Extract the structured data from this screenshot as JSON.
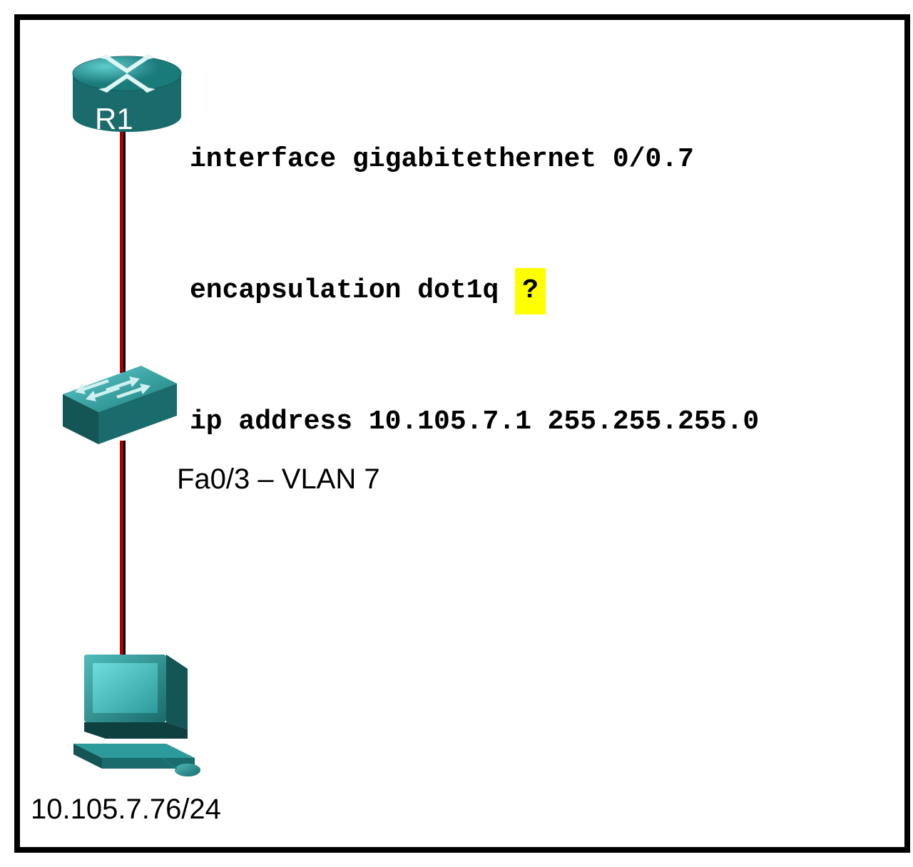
{
  "devices": {
    "router": {
      "label": "R1"
    },
    "switch": {
      "port_label": "Fa0/3 – VLAN 7"
    },
    "pc": {
      "ip_label": "10.105.7.76/24"
    }
  },
  "config": {
    "line1": "interface gigabitethernet 0/0.7",
    "line2_prefix": "encapsulation dot1q ",
    "line2_highlight": "?",
    "line3": "ip address 10.105.7.1 255.255.255.0"
  }
}
